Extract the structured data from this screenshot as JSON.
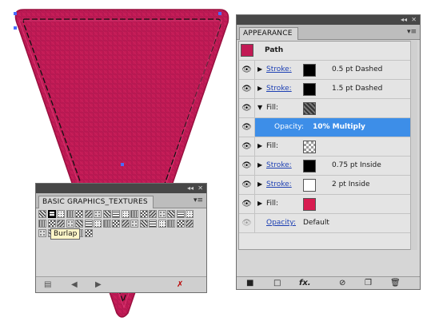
{
  "colors": {
    "artwork_fill": "#c21a55",
    "path_swatch": "#c21a55",
    "selection_blue": "#3d8ee8",
    "selection_handle": "#4a6cff"
  },
  "appearance": {
    "tab_label": "APPEARANCE",
    "header_label": "Path",
    "rows": [
      {
        "kind": "stroke",
        "label": "Stroke:",
        "swatch": "#000000",
        "value": "0.5 pt Dashed"
      },
      {
        "kind": "stroke",
        "label": "Stroke:",
        "swatch": "#000000",
        "value": "1.5 pt Dashed"
      },
      {
        "kind": "fill",
        "label": "Fill:",
        "swatch": "texture",
        "value": ""
      },
      {
        "kind": "opacity-selected",
        "label": "Opacity:",
        "value": "10% Multiply"
      },
      {
        "kind": "fill",
        "label": "Fill:",
        "swatch": "checker",
        "value": ""
      },
      {
        "kind": "stroke",
        "label": "Stroke:",
        "swatch": "#000000",
        "value": "0.75 pt  Inside"
      },
      {
        "kind": "stroke",
        "label": "Stroke:",
        "swatch": "#ffffff",
        "value": "2 pt  Inside"
      },
      {
        "kind": "fill",
        "label": "Fill:",
        "swatch": "#d81b50",
        "value": ""
      },
      {
        "kind": "opacity",
        "label": "Opacity:",
        "value": "Default"
      }
    ],
    "bottom_icons": [
      "new-art-icon",
      "clear-icon",
      "fx-icon",
      "reduce-icon",
      "duplicate-icon",
      "delete-icon"
    ],
    "fx_label": "fx."
  },
  "textures": {
    "tab_label": "BASIC GRAPHICS_TEXTURES",
    "tooltip": "Burlap",
    "selected_index": 1,
    "footer_icons": [
      "library-icon",
      "prev-arrow-icon",
      "next-arrow-icon",
      "delete-icon"
    ]
  }
}
